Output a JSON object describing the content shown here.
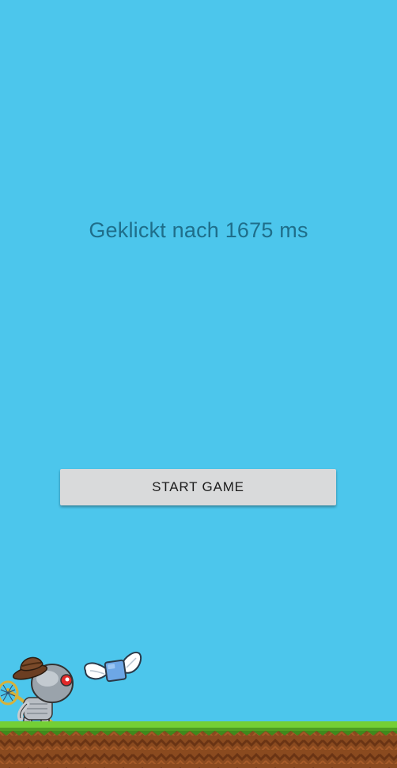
{
  "result": {
    "text": "Geklickt nach 1675 ms"
  },
  "start_button": {
    "label": "START GAME"
  },
  "colors": {
    "sky": "#4cc6ec",
    "text": "#1f6e8a",
    "button_bg": "#d9dadb",
    "grass": "#5fbf2f",
    "dirt": "#8a4a1f"
  },
  "sprites": {
    "player": "robot-player-with-net",
    "item": "winged-blue-box"
  }
}
